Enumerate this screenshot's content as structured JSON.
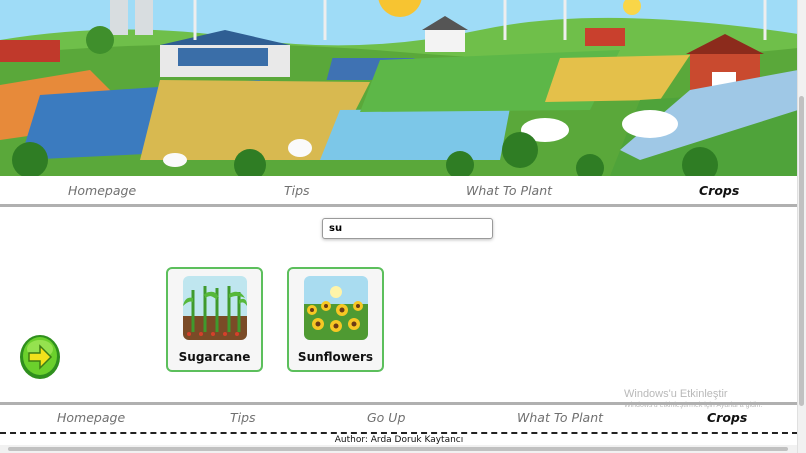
{
  "nav_top": [
    {
      "label": "Homepage",
      "active": false
    },
    {
      "label": "Tips",
      "active": false
    },
    {
      "label": "What To Plant",
      "active": false
    },
    {
      "label": "Crops",
      "active": true
    }
  ],
  "search": {
    "value": "su"
  },
  "cards": [
    {
      "label": "Sugarcane"
    },
    {
      "label": "Sunflowers"
    }
  ],
  "nav_bottom": [
    {
      "label": "Homepage",
      "active": false
    },
    {
      "label": "Tips",
      "active": false
    },
    {
      "label": "Go Up",
      "active": false
    },
    {
      "label": "What To Plant",
      "active": false
    },
    {
      "label": "Crops",
      "active": true
    }
  ],
  "footer": {
    "author": "Author: Arda Doruk Kaytancı"
  },
  "watermark": {
    "title": "Windows'u Etkinleştir",
    "subtitle": "Windows'u etkinleştirmek için Ayarlar'a gidin."
  },
  "icons": {
    "next": "next-arrow-icon"
  },
  "colors": {
    "card_border": "#5cbf5c",
    "nav_rule": "#b0b0b0",
    "accent_green": "#4caf2a"
  }
}
